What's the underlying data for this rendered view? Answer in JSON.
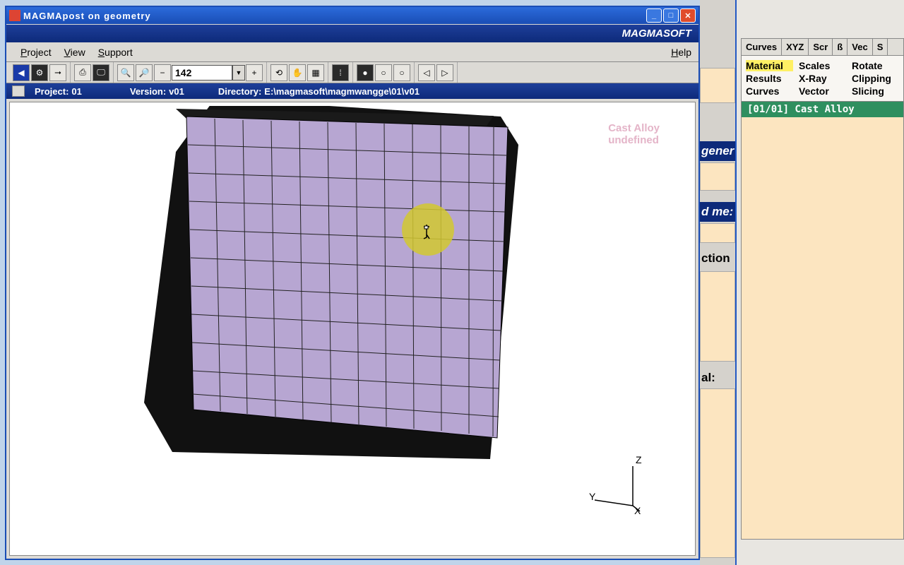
{
  "window": {
    "title": "MAGMApost on geometry",
    "brand": "MAGMASOFT"
  },
  "menu": {
    "project": "Project",
    "view": "View",
    "support": "Support",
    "help": "Help"
  },
  "toolbar": {
    "zoom_value": "142"
  },
  "statusbar": {
    "project_label": "Project:",
    "project_value": "01",
    "version_label": "Version:",
    "version_value": "v01",
    "directory_label": "Directory:",
    "directory_value": "E:\\magmasoft\\magmwangge\\01\\v01"
  },
  "legend": {
    "line1": "Cast Alloy",
    "line2": "undefined"
  },
  "axes": {
    "x": "X",
    "y": "Y",
    "z": "Z"
  },
  "right": {
    "tabs": [
      "Curves",
      "XYZ",
      "Scr",
      "ß",
      "Vec",
      "S"
    ],
    "grid": {
      "r1c1": "Material",
      "r1c2": "Scales",
      "r1c3": "Rotate",
      "r2c1": "Results",
      "r2c2": "X-Ray",
      "r2c3": "Clipping",
      "r3c1": "Curves",
      "r3c2": "Vector",
      "r3c3": "Slicing"
    },
    "list_header": "[01/01]  Cast Alloy"
  },
  "frag": {
    "gener": "gener",
    "dmes": "d me:",
    "ction": "ction",
    "al": "al:"
  }
}
